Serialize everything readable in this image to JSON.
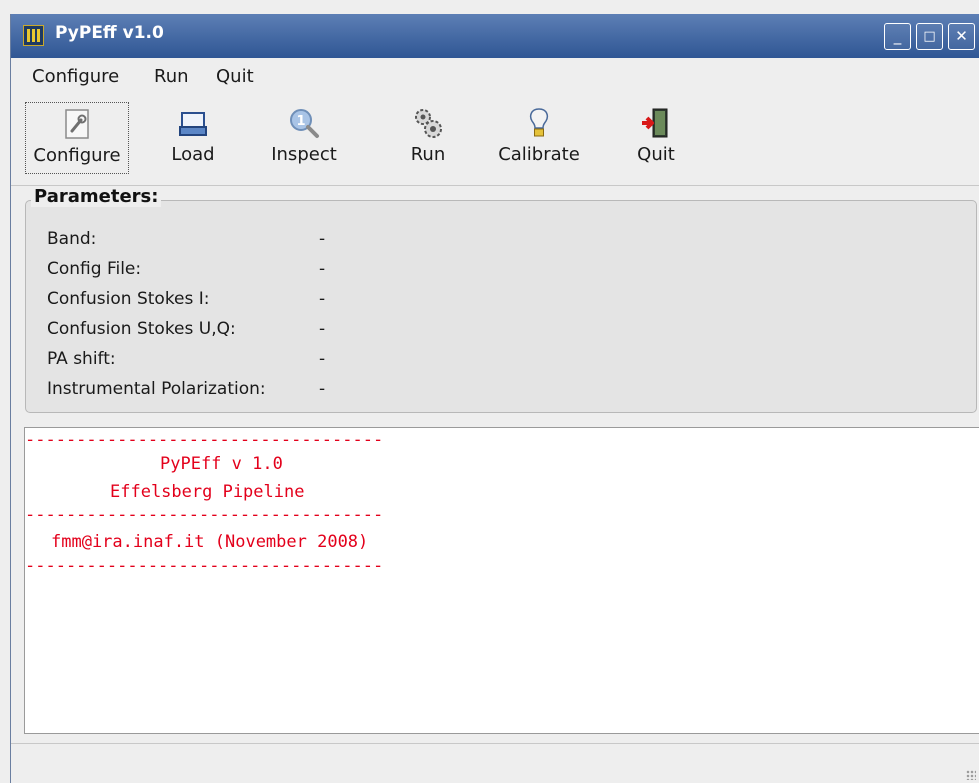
{
  "window": {
    "title": "PyPEff v1.0",
    "controls": {
      "minimize": "_",
      "maximize": "□",
      "close": "✕"
    }
  },
  "menu": {
    "items": [
      {
        "label": "Configure"
      },
      {
        "label": "Run"
      },
      {
        "label": "Quit"
      }
    ]
  },
  "toolbar": {
    "buttons": [
      {
        "label": "Configure",
        "icon": "configure-wrench-icon"
      },
      {
        "label": "Load",
        "icon": "load-tray-icon"
      },
      {
        "label": "Inspect",
        "icon": "magnifier-icon"
      },
      {
        "label": "Run",
        "icon": "gears-icon"
      },
      {
        "label": "Calibrate",
        "icon": "lightbulb-icon"
      },
      {
        "label": "Quit",
        "icon": "exit-door-icon"
      }
    ]
  },
  "parameters": {
    "title": "Parameters:",
    "rows": [
      {
        "label": "Band:",
        "value": "-"
      },
      {
        "label": "Config File:",
        "value": "-"
      },
      {
        "label": "Confusion Stokes I:",
        "value": "-"
      },
      {
        "label": "Confusion Stokes U,Q:",
        "value": "-"
      },
      {
        "label": "PA shift:",
        "value": "-"
      },
      {
        "label": "Instrumental Polarization:",
        "value": "-"
      }
    ]
  },
  "console": {
    "separator": "-----------------------------------",
    "program": "PyPEff v 1.0",
    "subtitle": "Effelsberg Pipeline",
    "contact": "fmm@ira.inaf.it (November 2008)",
    "text_color": "#e3001b"
  },
  "colors": {
    "titlebar": "#3a6199",
    "background": "#eeeeee"
  }
}
